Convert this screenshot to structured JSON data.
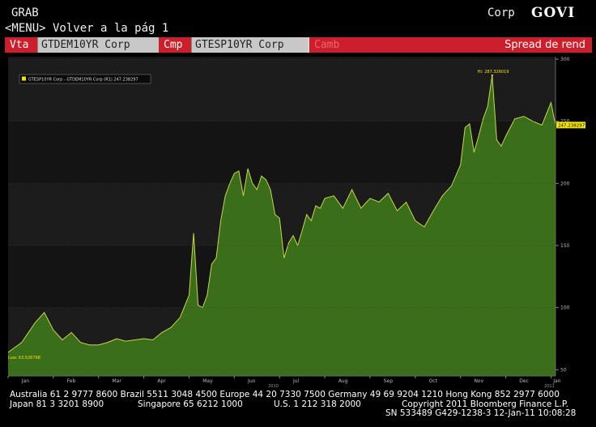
{
  "header": {
    "grab": "GRAB",
    "menu": "<MENU> Volver a la pág 1",
    "corp": "Corp",
    "govi": "GOVI"
  },
  "toolbar": {
    "vta_label": "Vta",
    "vta_value": "GTDEM10YR Corp",
    "cmp_label": "Cmp",
    "cmp_value": "GTESP10YR Corp",
    "camb_label": "Camb",
    "spread_label": "Spread de rend"
  },
  "chart_data": {
    "type": "area",
    "legend": "GTESP10YR Corp - GTDEM10YR Corp (R1) 247.238297",
    "hi_label": "Hi: 287.326019",
    "low_label": "Low: 63.526798",
    "last_label": "247.238297",
    "year_label": "2010",
    "year_label_end": "2011",
    "months": [
      "Jan",
      "Feb",
      "Mar",
      "Apr",
      "May",
      "Jun",
      "Jul",
      "Aug",
      "Sep",
      "Oct",
      "Nov",
      "Dec",
      "Jan"
    ],
    "yticks": [
      50,
      100,
      150,
      200,
      250,
      300
    ],
    "ylim": [
      45,
      302
    ],
    "x": [
      0,
      0.3,
      0.6,
      0.8,
      1.0,
      1.2,
      1.4,
      1.6,
      1.8,
      2.0,
      2.2,
      2.4,
      2.6,
      2.8,
      3.0,
      3.2,
      3.4,
      3.6,
      3.8,
      4.0,
      4.1,
      4.2,
      4.3,
      4.4,
      4.5,
      4.6,
      4.7,
      4.8,
      4.9,
      5.0,
      5.1,
      5.2,
      5.3,
      5.4,
      5.5,
      5.6,
      5.7,
      5.8,
      5.9,
      6.0,
      6.1,
      6.2,
      6.3,
      6.4,
      6.5,
      6.6,
      6.7,
      6.8,
      6.9,
      7.0,
      7.2,
      7.4,
      7.6,
      7.8,
      8.0,
      8.2,
      8.4,
      8.6,
      8.8,
      9.0,
      9.2,
      9.4,
      9.6,
      9.8,
      10.0,
      10.1,
      10.2,
      10.3,
      10.4,
      10.5,
      10.6,
      10.7,
      10.8,
      10.9,
      11.0,
      11.2,
      11.4,
      11.6,
      11.8,
      12.0,
      12.1
    ],
    "values": [
      64,
      72,
      88,
      96,
      82,
      74,
      80,
      72,
      70,
      70,
      72,
      75,
      73,
      74,
      75,
      74,
      80,
      84,
      92,
      110,
      160,
      102,
      100,
      110,
      135,
      140,
      170,
      190,
      200,
      208,
      210,
      190,
      212,
      200,
      195,
      206,
      203,
      195,
      175,
      172,
      140,
      152,
      158,
      150,
      162,
      175,
      170,
      182,
      180,
      188,
      190,
      180,
      195,
      180,
      188,
      185,
      192,
      178,
      185,
      170,
      165,
      178,
      190,
      198,
      215,
      245,
      248,
      225,
      238,
      252,
      262,
      287,
      235,
      230,
      238,
      252,
      254,
      250,
      247,
      265,
      247
    ]
  },
  "footer": {
    "line1": "Australia 61 2 9777 8600 Brazil 5511 3048 4500 Europe 44 20 7330 7500 Germany 49 69 9204 1210 Hong Kong 852 2977 6000",
    "line2a": "Japan 81 3 3201 8900",
    "line2b": "Singapore 65 6212 1000",
    "line2c": "U.S. 1 212 318 2000",
    "line2d": "Copyright 2011 Bloomberg Finance L.P.",
    "line3": "SN 533489 G429-1238-3 12-Jan-11 10:08:28"
  }
}
